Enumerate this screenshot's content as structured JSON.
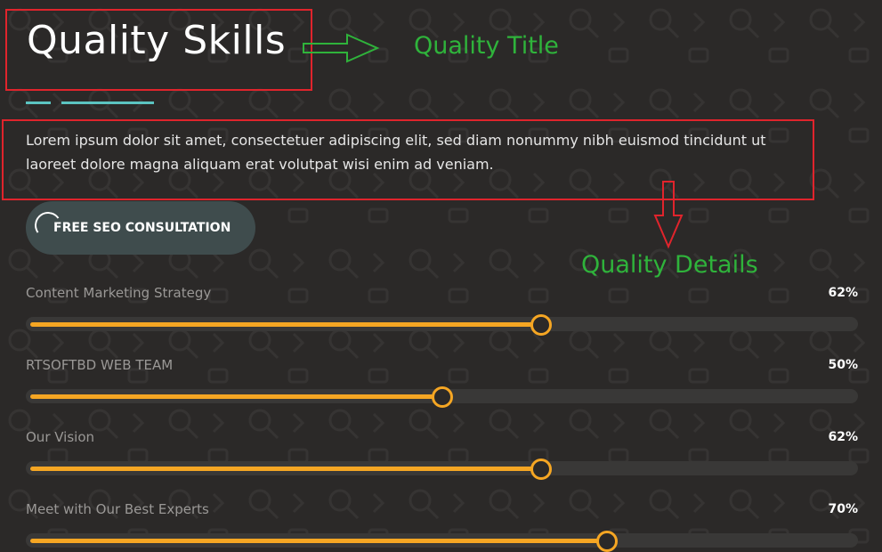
{
  "section": {
    "title": "Quality Skills",
    "description": "Lorem ipsum dolor sit amet, consectetuer adipiscing elit, sed diam nonummy nibh euismod tincidunt ut laoreet dolore magna aliquam erat volutpat wisi enim ad veniam.",
    "cta_label": "FREE SEO CONSULTATION"
  },
  "annotations": {
    "title_label": "Quality Title",
    "details_label": "Quality Details",
    "color": "#2fb33b",
    "box_color": "#e0242c"
  },
  "skills": [
    {
      "label": "Content Marketing Strategy",
      "value_text": "62%",
      "value": 62
    },
    {
      "label": "RTSOFTBD WEB TEAM",
      "value_text": "50%",
      "value": 50
    },
    {
      "label": "Our Vision",
      "value_text": "62%",
      "value": 62
    },
    {
      "label": "Meet with Our Best Experts",
      "value_text": "70%",
      "value": 70
    }
  ],
  "colors": {
    "accent": "#f5a623",
    "decor_line": "#5bc4c1",
    "button_bg": "#3f4c4d"
  }
}
